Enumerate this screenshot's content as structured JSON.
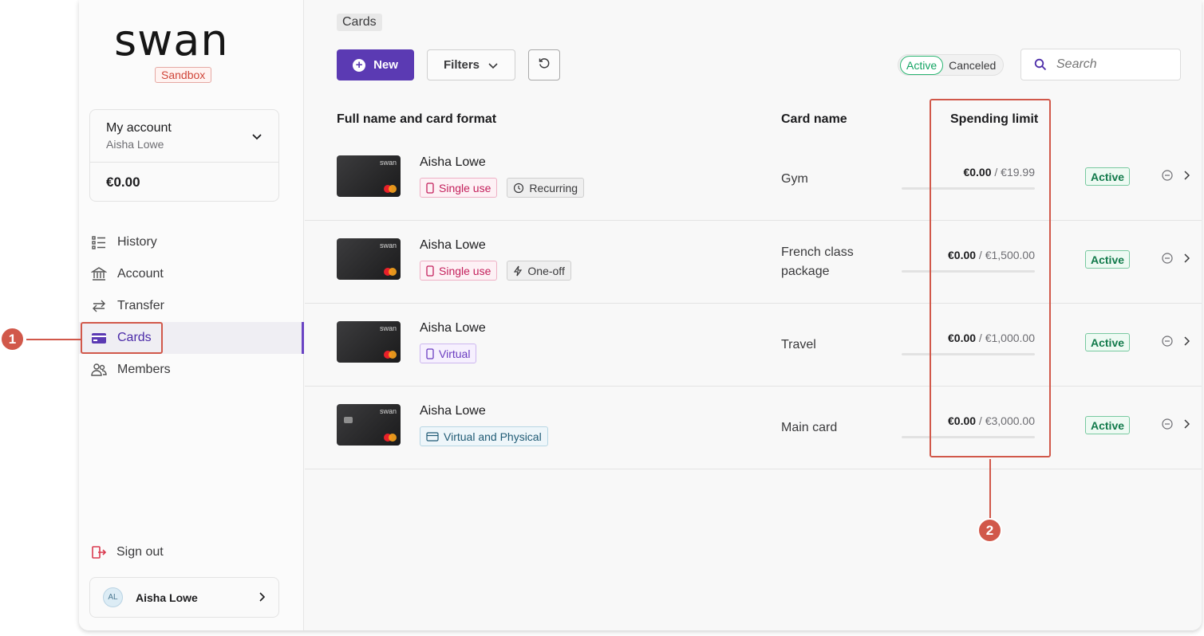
{
  "brand": {
    "logo": "swan",
    "environment": "Sandbox"
  },
  "account": {
    "title": "My account",
    "user": "Aisha Lowe",
    "balance": "€0.00"
  },
  "nav": [
    {
      "label": "History",
      "icon": "list-icon"
    },
    {
      "label": "Account",
      "icon": "bank-icon"
    },
    {
      "label": "Transfer",
      "icon": "transfer-icon"
    },
    {
      "label": "Cards",
      "icon": "card-icon",
      "active": true
    },
    {
      "label": "Members",
      "icon": "members-icon"
    }
  ],
  "sign_out": "Sign out",
  "user": {
    "initials": "AL",
    "name": "Aisha Lowe"
  },
  "breadcrumb": "Cards",
  "toolbar": {
    "new_label": "New",
    "filters_label": "Filters",
    "status_active": "Active",
    "status_canceled": "Canceled",
    "search_placeholder": "Search"
  },
  "table": {
    "headers": {
      "name": "Full name and card format",
      "card_name": "Card name",
      "limit": "Spending limit"
    },
    "rows": [
      {
        "holder": "Aisha Lowe",
        "tags": [
          {
            "label": "Single use",
            "kind": "single"
          },
          {
            "label": "Recurring",
            "kind": "neutral"
          }
        ],
        "card_name": "Gym",
        "spent": "€0.00",
        "limit": " / €19.99",
        "spent_fraction": 0,
        "status": "Active"
      },
      {
        "holder": "Aisha Lowe",
        "tags": [
          {
            "label": "Single use",
            "kind": "single"
          },
          {
            "label": "One-off",
            "kind": "neutral"
          }
        ],
        "card_name": "French class package",
        "spent": "€0.00",
        "limit": " / €1,500.00",
        "spent_fraction": 0,
        "status": "Active"
      },
      {
        "holder": "Aisha Lowe",
        "tags": [
          {
            "label": "Virtual",
            "kind": "virtual"
          }
        ],
        "card_name": "Travel",
        "spent": "€0.00",
        "limit": " / €1,000.00",
        "spent_fraction": 0,
        "status": "Active"
      },
      {
        "holder": "Aisha Lowe",
        "tags": [
          {
            "label": "Virtual and Physical",
            "kind": "vp"
          }
        ],
        "card_name": "Main card",
        "spent": "€0.00",
        "limit": " / €3,000.00",
        "spent_fraction": 0,
        "status": "Active"
      }
    ]
  },
  "annotations": {
    "one": "1",
    "two": "2"
  },
  "colors": {
    "accent": "#5b3ab3",
    "annotation": "#d1584a",
    "active_green": "#127a4b"
  }
}
